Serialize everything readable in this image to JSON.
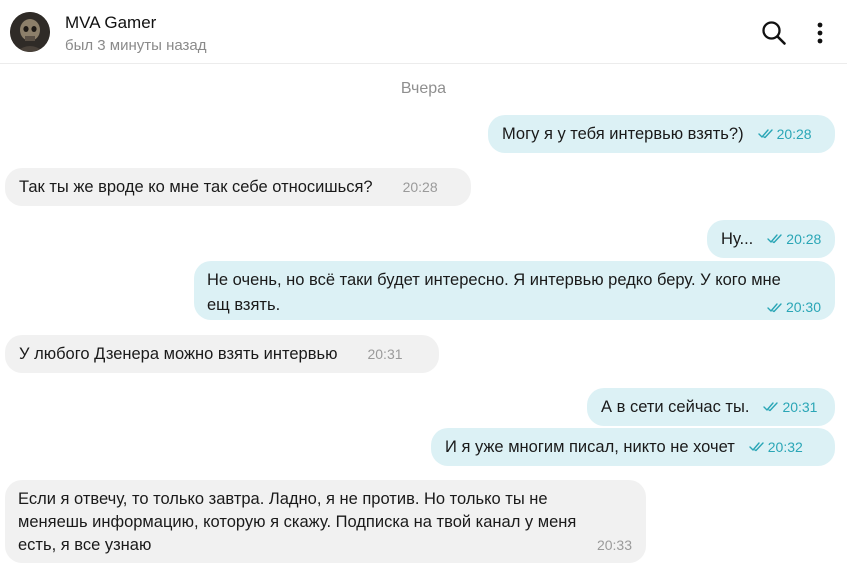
{
  "header": {
    "title": "MVA Gamer",
    "status": "был 3 минуты назад"
  },
  "date_separator": "Вчера",
  "messages": [
    {
      "direction": "out",
      "text": "Могу я у тебя интервью взять?)",
      "time": "20:28",
      "read": true
    },
    {
      "direction": "in",
      "text": "Так ты же вроде ко мне так себе относишься?",
      "time": "20:28"
    },
    {
      "direction": "out",
      "text": "Ну...",
      "time": "20:28",
      "read": true
    },
    {
      "direction": "out",
      "text_line1": "Не очень, но всё таки будет интересно. Я интервью редко беру. У кого мне",
      "text_line2": "ещ взять.",
      "time": "20:30",
      "read": true
    },
    {
      "direction": "in",
      "text": "У любого Дзенера можно взять интервью",
      "time": "20:31"
    },
    {
      "direction": "out",
      "text": "А в сети сейчас ты.",
      "time": "20:31",
      "read": true
    },
    {
      "direction": "out",
      "text": "И я уже многим писал, никто не хочет",
      "time": "20:32",
      "read": true
    },
    {
      "direction": "in",
      "text_line1": "Если я отвечу, то только завтра. Ладно, я не против. Но только ты не",
      "text_line2": "меняешь информацию, которую я скажу. Подписка на твой канал у меня",
      "text_line3": "есть, я все узнаю",
      "time": "20:33"
    }
  ],
  "icons": {
    "search": "search-icon",
    "menu": "more-vertical-icon",
    "read": "double-check-icon"
  },
  "colors": {
    "outgoing_bubble": "#dcf1f5",
    "incoming_bubble": "#f1f1f1",
    "accent": "#2aa6b6"
  }
}
